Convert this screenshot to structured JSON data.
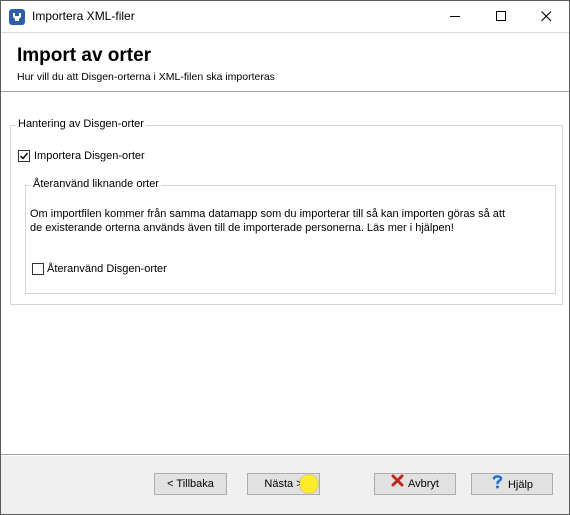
{
  "window": {
    "title": "Importera XML-filer",
    "controls": {
      "minimize": "minimize-icon",
      "maximize": "maximize-icon",
      "close": "close-icon"
    }
  },
  "header": {
    "title": "Import av orter",
    "subtitle": "Hur vill du att Disgen-orterna i XML-filen ska importeras"
  },
  "group_main": {
    "legend": "Hantering av Disgen-orter",
    "import_checkbox": {
      "label": "Importera Disgen-orter",
      "checked": true
    }
  },
  "group_reuse": {
    "legend": "Återanvänd liknande orter",
    "info_line1": "Om importfilen kommer från samma datamapp som du importerar till så kan importen göras så att",
    "info_line2": "de existerande orterna används även till de importerade personerna. Läs mer i hjälpen!",
    "reuse_checkbox": {
      "label": "Återanvänd Disgen-orter",
      "checked": false
    }
  },
  "buttons": {
    "back": "< Tillbaka",
    "next": "Nästa >",
    "cancel": "Avbryt",
    "help": "Hjälp"
  },
  "colors": {
    "cancel_icon": "#c0281c",
    "help_icon": "#1e6fd0",
    "cursor": "#ffeb2a"
  }
}
